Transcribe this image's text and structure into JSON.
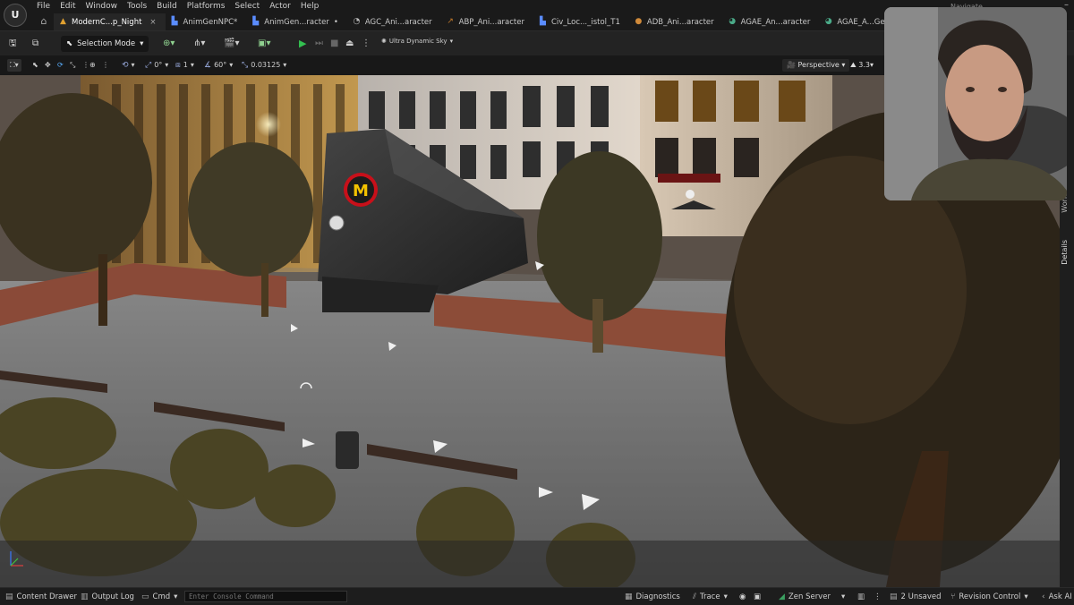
{
  "app": {
    "logo_text": "U",
    "user_name": "Navigate"
  },
  "menu": {
    "items": [
      "File",
      "Edit",
      "Window",
      "Tools",
      "Build",
      "Platforms",
      "Select",
      "Actor",
      "Help"
    ]
  },
  "tabs": [
    {
      "label": "ModernC...p_Night",
      "icon": "level-icon",
      "active": true
    },
    {
      "label": "AnimGenNPC*",
      "icon": "blueprint-icon",
      "active": false
    },
    {
      "label": "AnimGen...racter",
      "icon": "blueprint-icon",
      "active": false,
      "modified": true
    },
    {
      "label": "AGC_Ani...aracter",
      "icon": "anim-icon",
      "active": false
    },
    {
      "label": "ABP_Ani...aracter",
      "icon": "anim-bp-icon",
      "active": false
    },
    {
      "label": "Civ_Loc..._istol_T1",
      "icon": "blueprint-icon",
      "active": false
    },
    {
      "label": "ADB_Ani...aracter",
      "icon": "data-icon",
      "active": false
    },
    {
      "label": "AGAE_An...aracter",
      "icon": "anim-icon",
      "active": false
    },
    {
      "label": "AGAE_A...GenNPC",
      "icon": "anim-icon",
      "active": false
    }
  ],
  "toolbar": {
    "mode_label": "Selection Mode",
    "plugin_label": "Ultra Dynamic Sky"
  },
  "viewport_toolbar": {
    "rotation_snap": "0°",
    "grid_count": "1",
    "fov": "60°",
    "camera_speed": "0.03125",
    "view_mode": "Perspective",
    "scale_value": "3.3"
  },
  "scene": {
    "sign_letter": "M"
  },
  "right_dock": {
    "outliner_label": "World Outliner",
    "details_label": "Details"
  },
  "statusbar": {
    "content_drawer": "Content Drawer",
    "output_log": "Output Log",
    "cmd": "Cmd",
    "console_placeholder": "Enter Console Command",
    "diagnostics": "Diagnostics",
    "trace": "Trace",
    "zen_server": "Zen Server",
    "unsaved": "2 Unsaved",
    "revision_control": "Revision Control",
    "ask_ai": "Ask AI"
  },
  "colors": {
    "accent_play": "#33c050",
    "sign_red": "#c8101a",
    "sign_yellow": "#f2c200"
  }
}
